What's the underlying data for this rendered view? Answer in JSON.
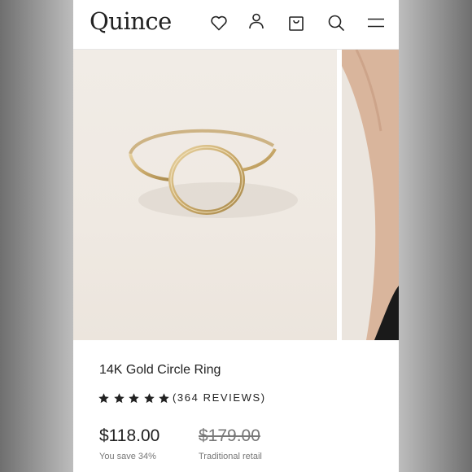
{
  "header": {
    "logo": "Quince",
    "icons": [
      "heart-icon",
      "account-icon",
      "shopping-bag-icon",
      "search-icon",
      "menu-icon"
    ]
  },
  "product": {
    "title": "14K Gold Circle Ring",
    "rating": 5,
    "reviews": "(364 REVIEWS)",
    "price": "$118.00",
    "savings": "You save 34%",
    "original_price": "$179.00",
    "original_label": "Traditional retail"
  },
  "colors": {
    "text": "#222222",
    "muted": "#777777",
    "gold": "#c9a96a",
    "photo_bg": "#efe9e2"
  }
}
